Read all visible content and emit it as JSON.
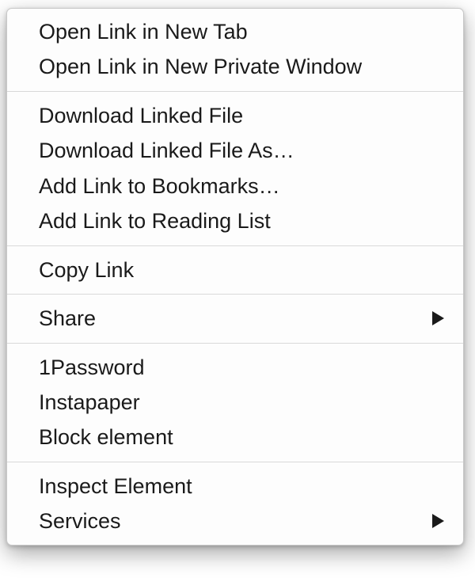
{
  "menu": {
    "groups": [
      {
        "items": [
          {
            "label": "Open Link in New Tab",
            "submenu": false
          },
          {
            "label": "Open Link in New Private Window",
            "submenu": false
          }
        ]
      },
      {
        "items": [
          {
            "label": "Download Linked File",
            "submenu": false
          },
          {
            "label": "Download Linked File As…",
            "submenu": false
          },
          {
            "label": "Add Link to Bookmarks…",
            "submenu": false
          },
          {
            "label": "Add Link to Reading List",
            "submenu": false
          }
        ]
      },
      {
        "items": [
          {
            "label": "Copy Link",
            "submenu": false
          }
        ]
      },
      {
        "items": [
          {
            "label": "Share",
            "submenu": true
          }
        ]
      },
      {
        "items": [
          {
            "label": "1Password",
            "submenu": false
          },
          {
            "label": "Instapaper",
            "submenu": false
          },
          {
            "label": "Block element",
            "submenu": false
          }
        ]
      },
      {
        "items": [
          {
            "label": "Inspect Element",
            "submenu": false
          },
          {
            "label": "Services",
            "submenu": true
          }
        ]
      }
    ]
  }
}
